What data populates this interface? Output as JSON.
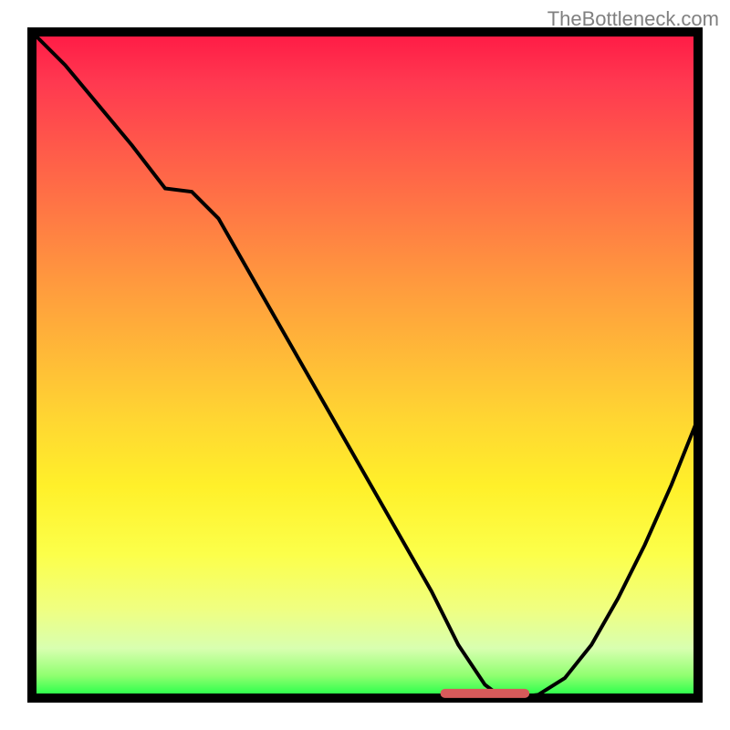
{
  "watermark": "TheBottleneck.com",
  "chart_data": {
    "type": "line",
    "title": "",
    "xlabel": "",
    "ylabel": "",
    "x": [
      0,
      5,
      10,
      15,
      20,
      24,
      28,
      32,
      36,
      40,
      44,
      48,
      52,
      56,
      60,
      62,
      64,
      66,
      68,
      70,
      72,
      76,
      80,
      84,
      88,
      92,
      96,
      100
    ],
    "values": [
      100,
      95,
      89,
      83,
      76.5,
      76,
      72,
      65,
      58,
      51,
      44,
      37,
      30,
      23,
      16,
      12,
      8,
      5,
      2,
      0.5,
      0,
      0.5,
      3,
      8,
      15,
      23,
      32,
      42
    ],
    "xlim": [
      0,
      100
    ],
    "ylim": [
      0,
      100
    ],
    "marker": {
      "x_start": 62,
      "x_end": 74,
      "y": 0.7
    }
  }
}
